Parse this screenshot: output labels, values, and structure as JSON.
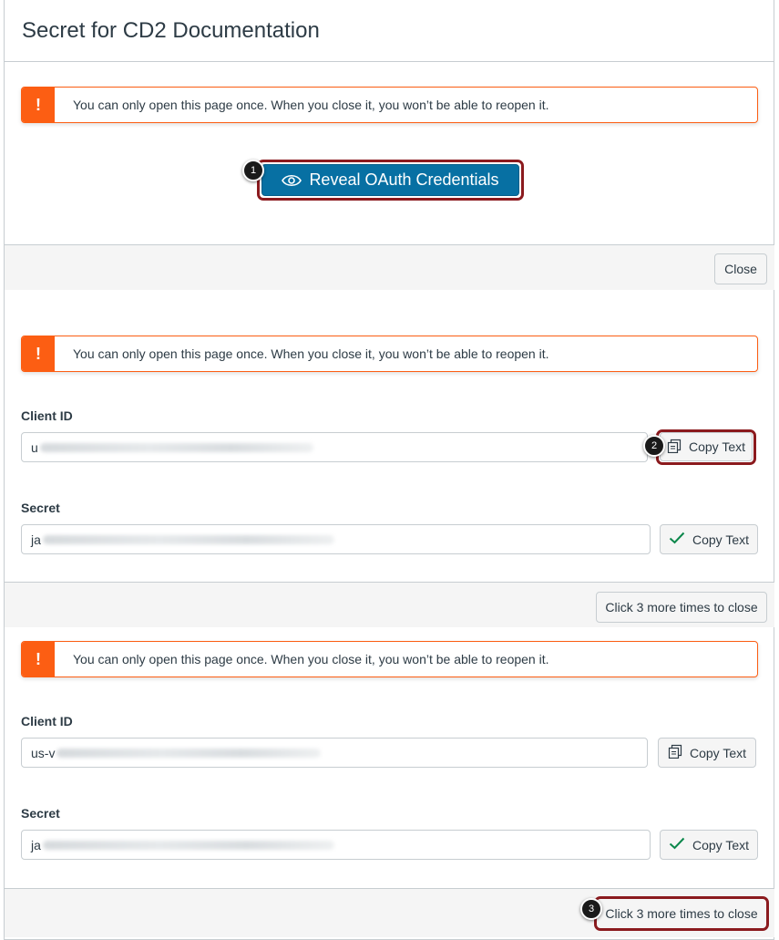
{
  "dialog": {
    "title": "Secret for CD2 Documentation",
    "alert_text": "You can only open this page once. When you close it, you won’t be able to reopen it.",
    "alert_icon": "!",
    "reveal_label": "Reveal OAuth Credentials",
    "close_label": "Close"
  },
  "panel2": {
    "client_id_label": "Client ID",
    "client_id_value": "u",
    "secret_label": "Secret",
    "secret_value": "ja",
    "copy_label": "Copy Text",
    "close_label": "Click 3 more times to close"
  },
  "panel3": {
    "client_id_label": "Client ID",
    "client_id_value": "us-v",
    "secret_label": "Secret",
    "secret_value": "ja",
    "copy_label": "Copy Text",
    "close_label": "Click 3 more times to close"
  },
  "callouts": [
    "1",
    "2",
    "3"
  ],
  "colors": {
    "alert": "#fc5e13",
    "primary": "#0770a3",
    "highlight": "#8b1a1e",
    "success": "#0b874b"
  },
  "icons": {
    "alert": "exclamation-icon",
    "reveal": "eye-icon",
    "copy": "copy-icon",
    "copied": "checkmark-icon"
  }
}
